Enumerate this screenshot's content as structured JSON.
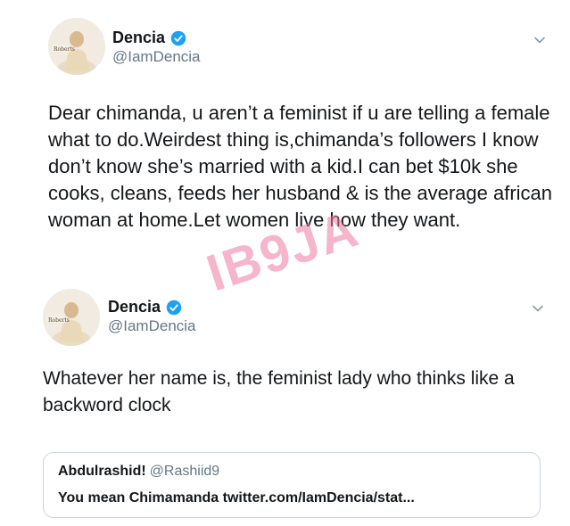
{
  "tweets": [
    {
      "name": "Dencia",
      "handle": "@IamDencia",
      "text": "Dear chimanda, u aren’t a feminist if u are telling a female what to do.Weirdest thing is,chimanda’s followers I know don’t know she’s married with a kid.I can bet $10k she cooks, cleans, feeds her husband & is the average african woman at home.Let women live how they want."
    },
    {
      "name": "Dencia",
      "handle": "@IamDencia",
      "text": "Whatever her name is, the feminist lady who thinks like a backword clock",
      "quote": {
        "name": "Abdulrashid!",
        "handle": "@Rashiid9",
        "text": "You mean Chimamanda twitter.com/IamDencia/stat..."
      }
    }
  ],
  "watermark": "IB9JA",
  "colors": {
    "verified": "#1da1f2",
    "secondary_text": "#657786",
    "watermark": "#ee78a0"
  },
  "icons": [
    "verified-badge-icon",
    "chevron-down-icon"
  ]
}
